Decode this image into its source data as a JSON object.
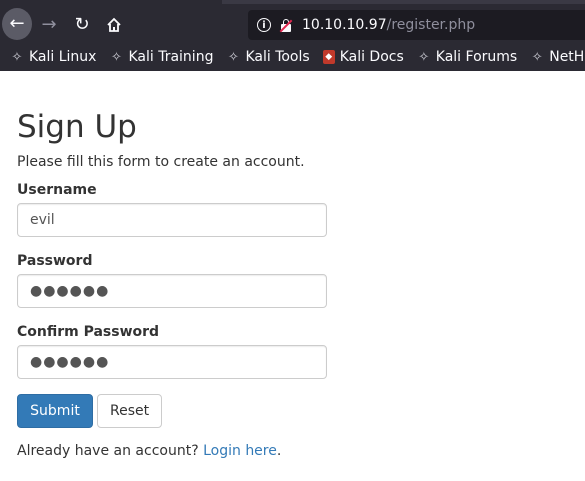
{
  "browser": {
    "url_host": "10.10.10.97",
    "url_path": "/register.php",
    "bookmarks": [
      {
        "label": "Kali Linux",
        "icon": "kali-dragon-icon"
      },
      {
        "label": "Kali Training",
        "icon": "kali-dragon-icon"
      },
      {
        "label": "Kali Tools",
        "icon": "kali-dragon-icon"
      },
      {
        "label": "Kali Docs",
        "icon": "kali-docs-icon"
      },
      {
        "label": "Kali Forums",
        "icon": "kali-dragon-icon"
      },
      {
        "label": "NetHun",
        "icon": "nethunter-icon"
      }
    ]
  },
  "page": {
    "title": "Sign Up",
    "subtitle": "Please fill this form to create an account.",
    "form": {
      "username_label": "Username",
      "username_value": "evil",
      "password_label": "Password",
      "password_value": "●●●●●●",
      "confirm_label": "Confirm Password",
      "confirm_value": "●●●●●●",
      "submit_label": "Submit",
      "reset_label": "Reset"
    },
    "footer": {
      "prefix": "Already have an account? ",
      "link_label": "Login here",
      "suffix": "."
    }
  },
  "colors": {
    "chrome_bg": "#2b2a33",
    "primary_button": "#337ab7",
    "link": "#337ab7",
    "insecure_red": "#e22850"
  }
}
